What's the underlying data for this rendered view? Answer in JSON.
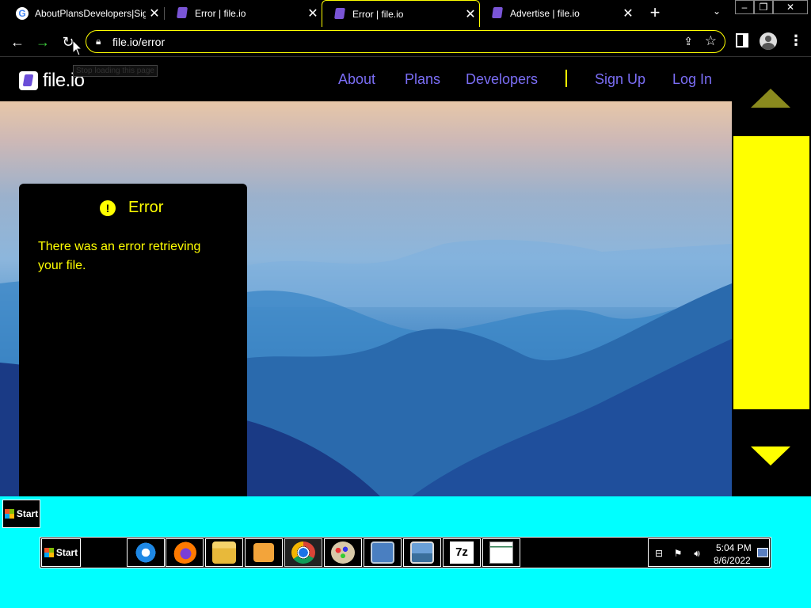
{
  "tabs": [
    {
      "title": "AboutPlansDevelopers|Sign",
      "favicon": "google-icon",
      "active": false
    },
    {
      "title": "Error | file.io",
      "favicon": "fileio-icon",
      "active": false
    },
    {
      "title": "Error | file.io",
      "favicon": "fileio-icon",
      "active": true
    },
    {
      "title": "Advertise | file.io",
      "favicon": "fileio-icon",
      "active": false
    }
  ],
  "tab_close": "✕",
  "new_tab": "+",
  "tab_search": "⌄",
  "window_buttons": {
    "minimize": "–",
    "restore": "❐",
    "close": "✕"
  },
  "toolbar": {
    "back": "←",
    "forward": "→",
    "reload": "↻",
    "url": "file.io/error",
    "tooltip": "Stop loading this page"
  },
  "site": {
    "logo": "file.io",
    "nav": [
      "About",
      "Plans",
      "Developers",
      "Sign Up",
      "Log In"
    ],
    "accent": "#7b6ef6",
    "highlight": "#ffff00"
  },
  "error_card": {
    "icon": "!",
    "title": "Error",
    "message": "There was an error retrieving your file."
  },
  "taskbar": {
    "start_label": "Start",
    "desktop_start_label": "Start",
    "apps": [
      "ie-icon",
      "firefox-icon",
      "file-explorer-icon",
      "media-player-icon",
      "chrome-icon",
      "paint-icon",
      "control-panel-icon",
      "photo-viewer-icon",
      "7zip-icon",
      "notepad-icon"
    ],
    "clock_time": "5:04 PM",
    "clock_date": "8/6/2022"
  }
}
